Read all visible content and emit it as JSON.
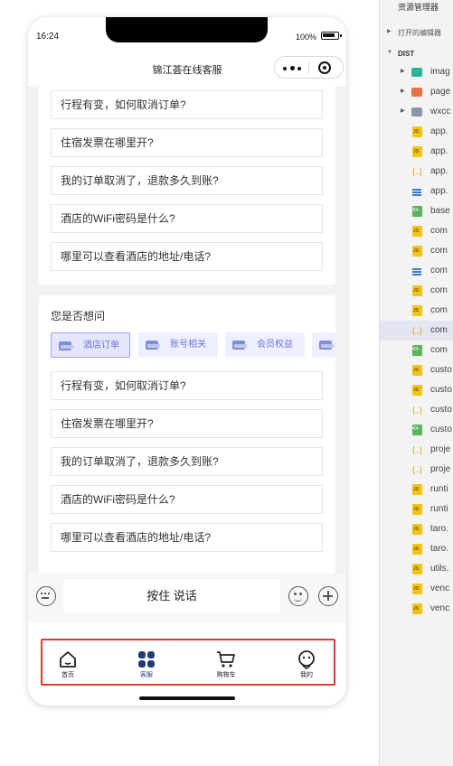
{
  "phone": {
    "status": {
      "time": "16:24",
      "battery_text": "100%"
    },
    "nav": {
      "title": "锦江荟在线客服"
    },
    "questions": [
      "行程有变，如何取消订单?",
      "住宿发票在哪里开?",
      "我的订单取消了，退款多久到账?",
      "酒店的WiFi密码是什么?",
      "哪里可以查看酒店的地址/电话?"
    ],
    "suggest": {
      "title": "您是否想问",
      "chips": [
        {
          "label": "酒店订单",
          "active": true
        },
        {
          "label": "账号相关",
          "active": false
        },
        {
          "label": "会员权益",
          "active": false
        }
      ],
      "questions": [
        "行程有变，如何取消订单?",
        "住宿发票在哪里开?",
        "我的订单取消了，退款多久到账?",
        "酒店的WiFi密码是什么?",
        "哪里可以查看酒店的地址/电话?"
      ]
    },
    "input": {
      "hold_to_talk": "按住 说话"
    },
    "tabbar": {
      "tabs": [
        {
          "label": "首页",
          "icon": "home-icon",
          "active": false
        },
        {
          "label": "客服",
          "icon": "grid-icon",
          "active": true
        },
        {
          "label": "购物车",
          "icon": "cart-icon",
          "active": false
        },
        {
          "label": "我的",
          "icon": "profile-icon",
          "active": false
        }
      ],
      "highlight_color": "#e53935",
      "active_color": "#1f3b78"
    }
  },
  "explorer": {
    "title": "资源管理器",
    "open_editors": "打开的编辑器",
    "root": "DIST",
    "items": [
      {
        "name": "imag",
        "type": "folder",
        "icon": "folder-teal-icon"
      },
      {
        "name": "page",
        "type": "folder",
        "icon": "folder-red-icon"
      },
      {
        "name": "wxcc",
        "type": "folder",
        "icon": "folder-gray-icon"
      },
      {
        "name": "app.",
        "type": "js",
        "icon": "js-file-icon"
      },
      {
        "name": "app.",
        "type": "js",
        "icon": "js-file-icon"
      },
      {
        "name": "app.",
        "type": "json",
        "icon": "json-file-icon"
      },
      {
        "name": "app.",
        "type": "css",
        "icon": "css-file-icon"
      },
      {
        "name": "base",
        "type": "wxml",
        "icon": "wxml-file-icon"
      },
      {
        "name": "com",
        "type": "js",
        "icon": "js-file-icon"
      },
      {
        "name": "com",
        "type": "js",
        "icon": "js-file-icon"
      },
      {
        "name": "com",
        "type": "css",
        "icon": "css-file-icon"
      },
      {
        "name": "com",
        "type": "js",
        "icon": "js-file-icon"
      },
      {
        "name": "com",
        "type": "js",
        "icon": "js-file-icon"
      },
      {
        "name": "com",
        "type": "json",
        "icon": "json-file-icon",
        "selected": true
      },
      {
        "name": "com",
        "type": "wxml",
        "icon": "wxml-file-icon"
      },
      {
        "name": "custo",
        "type": "js",
        "icon": "js-file-icon"
      },
      {
        "name": "custo",
        "type": "js",
        "icon": "js-file-icon"
      },
      {
        "name": "custo",
        "type": "json",
        "icon": "json-file-icon"
      },
      {
        "name": "custo",
        "type": "wxml",
        "icon": "wxml-file-icon"
      },
      {
        "name": "proje",
        "type": "json",
        "icon": "json-file-icon"
      },
      {
        "name": "proje",
        "type": "json",
        "icon": "json-file-icon"
      },
      {
        "name": "runti",
        "type": "js",
        "icon": "js-file-icon"
      },
      {
        "name": "runti",
        "type": "js",
        "icon": "js-file-icon"
      },
      {
        "name": "taro.",
        "type": "js",
        "icon": "js-file-icon"
      },
      {
        "name": "taro.",
        "type": "js",
        "icon": "js-file-icon"
      },
      {
        "name": "utils.",
        "type": "js",
        "icon": "js-file-icon"
      },
      {
        "name": "venc",
        "type": "js",
        "icon": "js-file-icon"
      },
      {
        "name": "venc",
        "type": "js",
        "icon": "js-file-icon"
      }
    ]
  }
}
